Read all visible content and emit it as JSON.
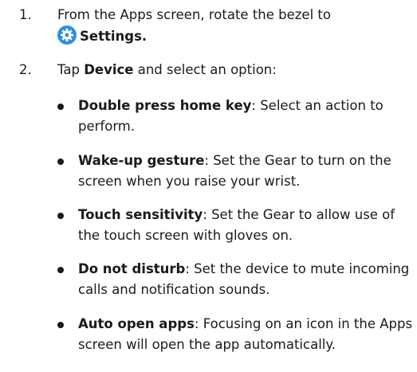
{
  "steps": [
    {
      "number": "1.",
      "text_before": "From the Apps screen, rotate the bezel to",
      "icon": "settings-gear-icon",
      "bold": "Settings.",
      "text_after": ""
    },
    {
      "number": "2.",
      "text_before": "Tap ",
      "bold": "Device",
      "text_after": " and select an option:"
    }
  ],
  "options": [
    {
      "term": "Double press home key",
      "desc": ": Select an action to perform."
    },
    {
      "term": "Wake-up gesture",
      "desc": ": Set the Gear to turn on the screen when you raise your wrist."
    },
    {
      "term": "Touch sensitivity",
      "desc": ": Set the Gear to allow use of the touch screen with gloves on."
    },
    {
      "term": "Do not disturb",
      "desc": ": Set the device to mute incoming calls and notification sounds."
    },
    {
      "term": "Auto open apps",
      "desc": ": Focusing on an icon in the Apps screen will open the app automatically."
    }
  ],
  "colors": {
    "text": "#1a1a1a",
    "icon_blue": "#2f8ee0"
  }
}
